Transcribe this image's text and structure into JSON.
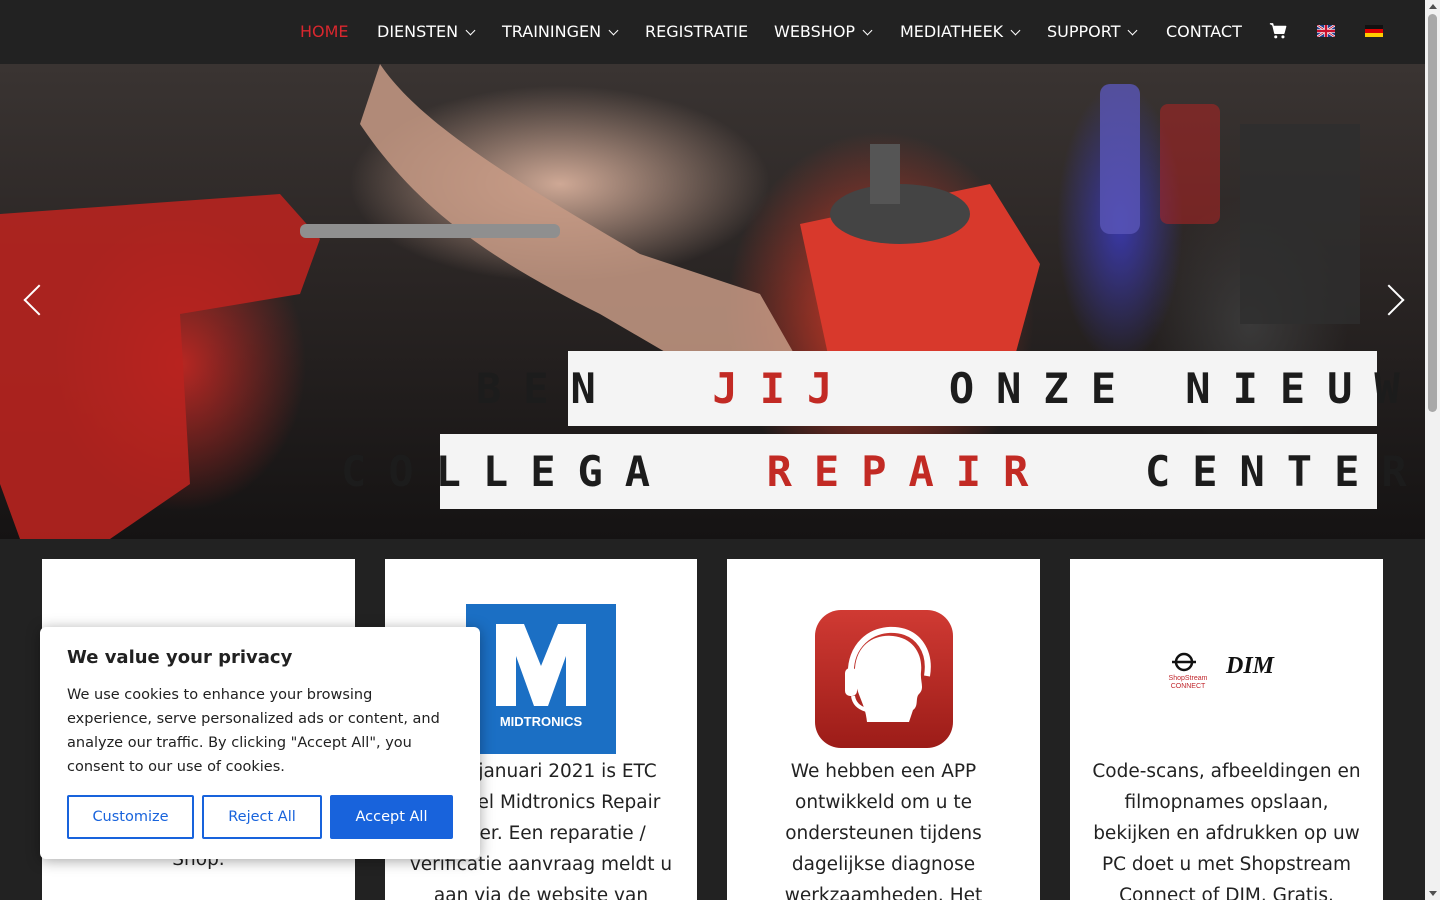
{
  "nav": {
    "items": [
      {
        "label": "HOME",
        "active": true,
        "dropdown": false
      },
      {
        "label": "DIENSTEN",
        "dropdown": true
      },
      {
        "label": "TRAININGEN",
        "dropdown": true
      },
      {
        "label": "REGISTRATIE",
        "dropdown": false
      },
      {
        "label": "WEBSHOP",
        "dropdown": true
      },
      {
        "label": "MEDIATHEEK",
        "dropdown": true
      },
      {
        "label": "SUPPORT",
        "dropdown": true
      },
      {
        "label": "CONTACT",
        "dropdown": false
      }
    ],
    "cart_icon": "shopping-cart-icon",
    "flags": [
      "flag-uk-icon",
      "flag-de-icon"
    ],
    "active_color": "#d9272e"
  },
  "hero": {
    "line1_pre": "BEN",
    "line1_highlight": "JIJ",
    "line1_post": "ONZE NIEUWE",
    "line2_pre": "COLLEGA",
    "line2_highlight": "REPAIR",
    "line2_post": "CENTER?",
    "prev_icon": "chevron-left-icon",
    "next_icon": "chevron-right-icon"
  },
  "cards": [
    {
      "text": "Shop."
    },
    {
      "logo_text": "MIDTRONICS",
      "text": "Per 1 januari 2021 is ETC officieel Midtronics Repair Center. Een reparatie / verificatie aanvraag meldt u aan via de website van"
    },
    {
      "text": "We hebben een APP ontwikkeld om u te ondersteunen tijdens dagelijkse diagnose werkzaamheden. Het"
    },
    {
      "logo_text_left": "ShopStream CONNECT",
      "logo_text_right": "DIM",
      "text": "Code-scans, afbeeldingen en filmopnames opslaan, bekijken en afdrukken op uw PC doet u met Shopstream Connect of DIM. Gratis."
    }
  ],
  "cookie": {
    "title": "We value your privacy",
    "body": "We use cookies to enhance your browsing experience, serve personalized ads or content, and analyze our traffic. By clicking \"Accept All\", you consent to our use of cookies.",
    "customize": "Customize",
    "reject": "Reject All",
    "accept": "Accept All",
    "accent": "#1863dc"
  }
}
